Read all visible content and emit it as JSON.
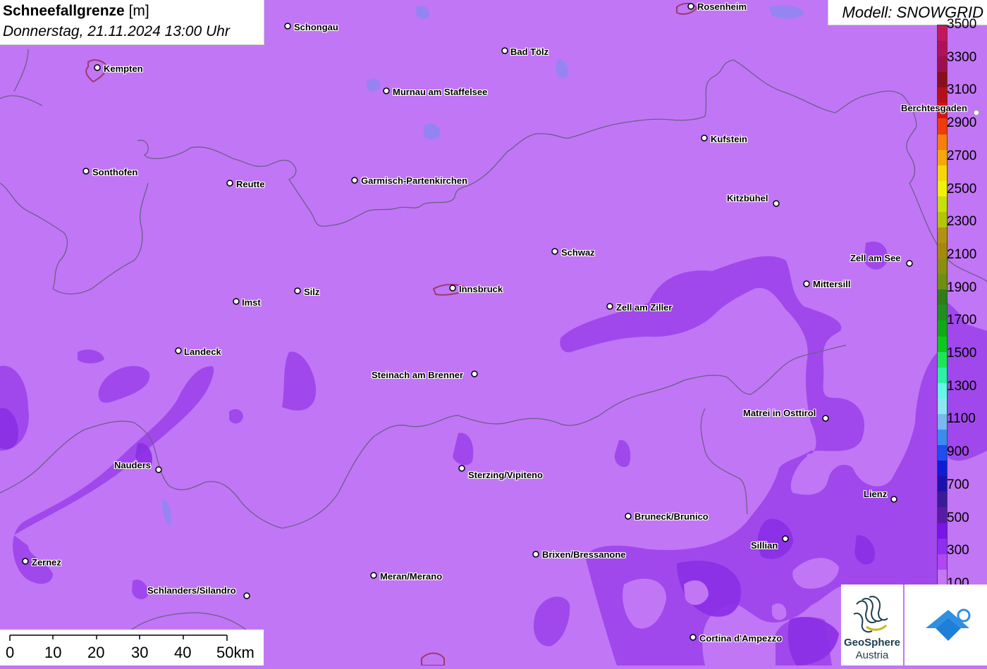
{
  "title": {
    "main": "Schneefallgrenze",
    "unit": "[m]",
    "subtitle": "Donnerstag, 21.11.2024 13:00 Uhr"
  },
  "model": {
    "label": "Modell: SNOWGRID"
  },
  "legend": {
    "labels": [
      "3500",
      "3300",
      "3100",
      "2900",
      "2700",
      "2500",
      "2300",
      "2100",
      "1900",
      "1700",
      "1500",
      "1300",
      "1100",
      "900",
      "700",
      "500",
      "300",
      "100"
    ],
    "colors": [
      "#c2185b",
      "#b0125a",
      "#9c1050",
      "#8a0f1c",
      "#b5101a",
      "#d41414",
      "#f03a0f",
      "#f4800b",
      "#f6a80a",
      "#f6d80a",
      "#f0f20c",
      "#c6e00c",
      "#b4c40b",
      "#b29210",
      "#a6880e",
      "#8a8f10",
      "#6e8f0f",
      "#2e7d1a",
      "#1f8f1e",
      "#12a818",
      "#0cc81e",
      "#1de55a",
      "#2ef0a8",
      "#66f5e6",
      "#8de6f4",
      "#7ab8f2",
      "#3c8cf0",
      "#1c4ef0",
      "#0e1cd8",
      "#1a12b0",
      "#3a1a98",
      "#5a1aa8",
      "#7a14e8",
      "#8e2ef0",
      "#b046f4",
      "#c576f6"
    ]
  },
  "scale": {
    "ticks": [
      "0",
      "10",
      "20",
      "30",
      "40",
      "50km"
    ]
  },
  "cities": [
    {
      "name": "Schongau"
    },
    {
      "name": "Rosenheim"
    },
    {
      "name": "Kempten"
    },
    {
      "name": "Bad Tölz"
    },
    {
      "name": "Murnau am Staffelsee"
    },
    {
      "name": "Berchtesgaden"
    },
    {
      "name": "Kufstein"
    },
    {
      "name": "Sonthofen"
    },
    {
      "name": "Reutte"
    },
    {
      "name": "Garmisch-Partenkirchen"
    },
    {
      "name": "Kitzbühel"
    },
    {
      "name": "Schwaz"
    },
    {
      "name": "Zell am See"
    },
    {
      "name": "Mittersill"
    },
    {
      "name": "Imst"
    },
    {
      "name": "Silz"
    },
    {
      "name": "Innsbruck"
    },
    {
      "name": "Zell am Ziller"
    },
    {
      "name": "Landeck"
    },
    {
      "name": "Steinach am Brenner"
    },
    {
      "name": "Matrei in Osttirol"
    },
    {
      "name": "Nauders"
    },
    {
      "name": "Sterzing/Vipiteno"
    },
    {
      "name": "Lienz"
    },
    {
      "name": "Bruneck/Brunico"
    },
    {
      "name": "Sillian"
    },
    {
      "name": "Brixen/Bressanone"
    },
    {
      "name": "Zernez"
    },
    {
      "name": "Meran/Merano"
    },
    {
      "name": "Schlanders/Silandro"
    },
    {
      "name": "Cortina d'Ampezzo"
    }
  ],
  "logo": {
    "line1": "GeoSphere",
    "line2": "Austria"
  },
  "colors": {
    "base": "#c176f6",
    "lower": "#a048ec",
    "lowest": "#8a2fe6",
    "border": "#6b5f86"
  }
}
